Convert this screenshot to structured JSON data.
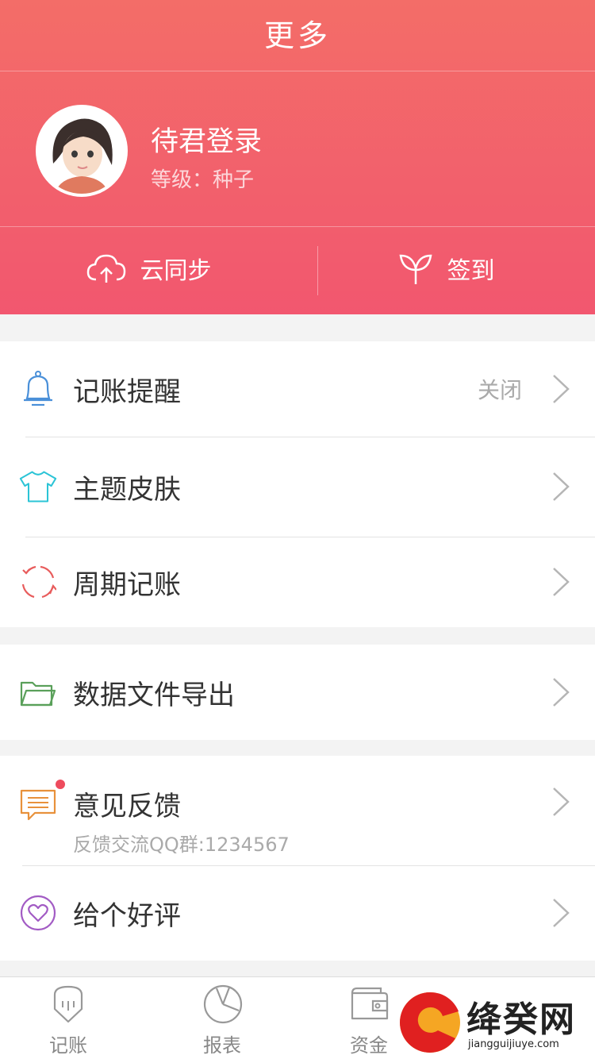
{
  "header": {
    "title": "更多",
    "username": "待君登录",
    "level": "等级：种子",
    "sync_label": "云同步",
    "checkin_label": "签到"
  },
  "menu": {
    "reminder": {
      "label": "记账提醒",
      "value": "关闭"
    },
    "theme": {
      "label": "主题皮肤"
    },
    "recurring": {
      "label": "周期记账"
    },
    "export": {
      "label": "数据文件导出"
    },
    "feedback": {
      "label": "意见反馈",
      "sub": "反馈交流QQ群:1234567"
    },
    "rate": {
      "label": "给个好评"
    }
  },
  "tabbar": {
    "tabs": [
      {
        "label": "记账",
        "icon": "pencil-icon"
      },
      {
        "label": "报表",
        "icon": "pie-chart-icon"
      },
      {
        "label": "资金",
        "icon": "wallet-icon"
      }
    ]
  },
  "watermark": {
    "text": "绛癸网",
    "url": "jiangguijiuye.com"
  },
  "colors": {
    "header_top": "#f36d68",
    "header_bottom": "#f2576f",
    "bell": "#4a90d9",
    "shirt": "#2bc4d6",
    "cycle": "#e85c5c",
    "folder": "#5aa05a",
    "feedback": "#e8913b",
    "heart": "#a25bc4"
  }
}
